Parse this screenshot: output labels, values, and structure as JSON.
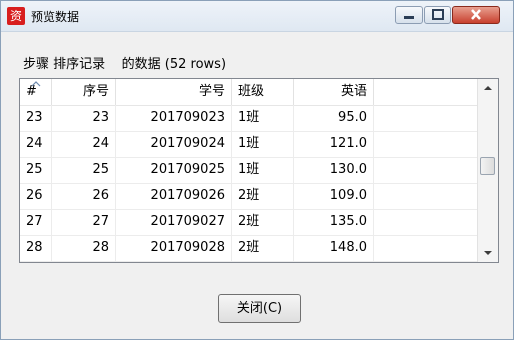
{
  "window": {
    "title": "预览数据",
    "app_icon_glyph": "资"
  },
  "caption": "步骤 排序记录    的数据 (52 rows)",
  "table": {
    "sort_indicator": "up",
    "columns": [
      "#",
      "序号",
      "学号",
      "班级",
      "英语"
    ],
    "rows": [
      [
        "23",
        "23",
        "201709023",
        "1班",
        "95.0"
      ],
      [
        "24",
        "24",
        "201709024",
        "1班",
        "121.0"
      ],
      [
        "25",
        "25",
        "201709025",
        "1班",
        "130.0"
      ],
      [
        "26",
        "26",
        "201709026",
        "2班",
        "109.0"
      ],
      [
        "27",
        "27",
        "201709027",
        "2班",
        "135.0"
      ],
      [
        "28",
        "28",
        "201709028",
        "2班",
        "148.0"
      ]
    ]
  },
  "buttons": {
    "close_label": "关闭(C)"
  },
  "colors": {
    "app_icon": "#d81e1e",
    "close_control": "#c8402e"
  }
}
